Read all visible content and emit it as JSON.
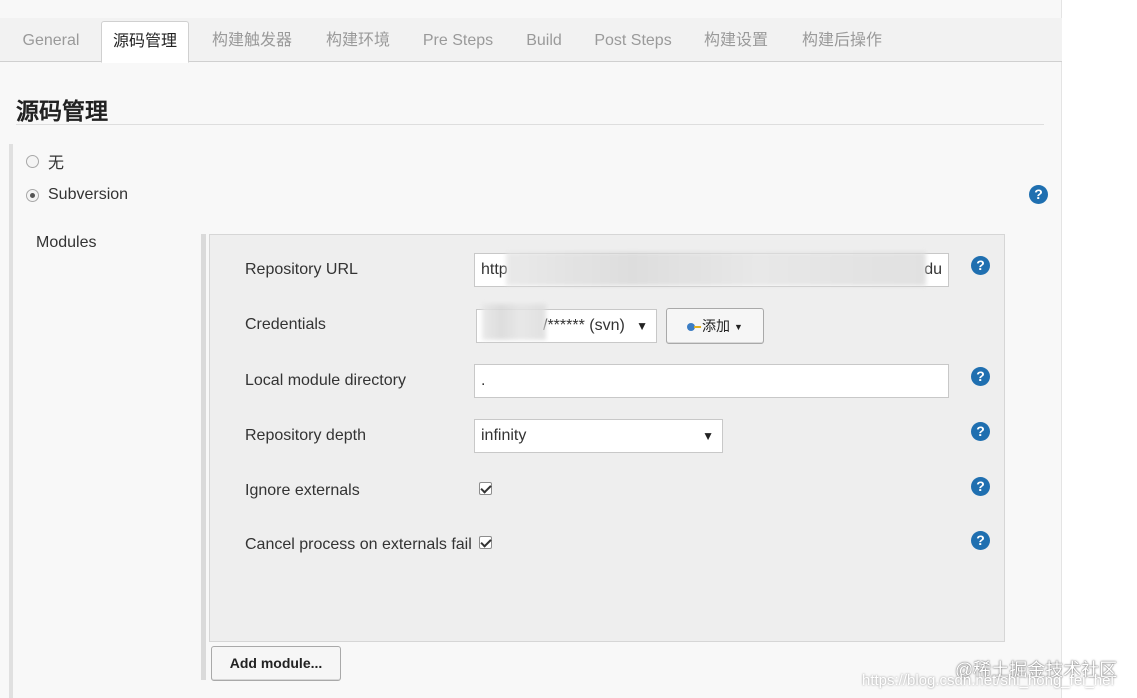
{
  "tabs": [
    {
      "label": "General",
      "active": false
    },
    {
      "label": "源码管理",
      "active": true
    },
    {
      "label": "构建触发器",
      "active": false
    },
    {
      "label": "构建环境",
      "active": false
    },
    {
      "label": "Pre Steps",
      "active": false
    },
    {
      "label": "Build",
      "active": false
    },
    {
      "label": "Post Steps",
      "active": false
    },
    {
      "label": "构建设置",
      "active": false
    },
    {
      "label": "构建后操作",
      "active": false
    }
  ],
  "section": {
    "title": "源码管理"
  },
  "scm_options": [
    {
      "label": "无",
      "checked": false
    },
    {
      "label": "Subversion",
      "checked": true
    }
  ],
  "modules": {
    "label": "Modules",
    "repository_url": {
      "label": "Repository URL",
      "value_visible_start": "http",
      "value_visible_end": "du"
    },
    "credentials": {
      "label": "Credentials",
      "selected": "/****** (svn)",
      "add_label": "添加"
    },
    "local_module_directory": {
      "label": "Local module directory",
      "value": "."
    },
    "repository_depth": {
      "label": "Repository depth",
      "selected": "infinity"
    },
    "ignore_externals": {
      "label": "Ignore externals",
      "checked": true
    },
    "cancel_process": {
      "label": "Cancel process on externals fail",
      "checked": true
    },
    "add_module_label": "Add module..."
  },
  "help_symbol": "?",
  "dropdown_arrow": "▼",
  "watermark": {
    "line1": "@稀土掘金技术社区",
    "line2": "https://blog.csdn.net/shi_hong_fei_hei"
  },
  "colors": {
    "help": "#1f6fb0",
    "accent_key": "#3b7dc4"
  }
}
